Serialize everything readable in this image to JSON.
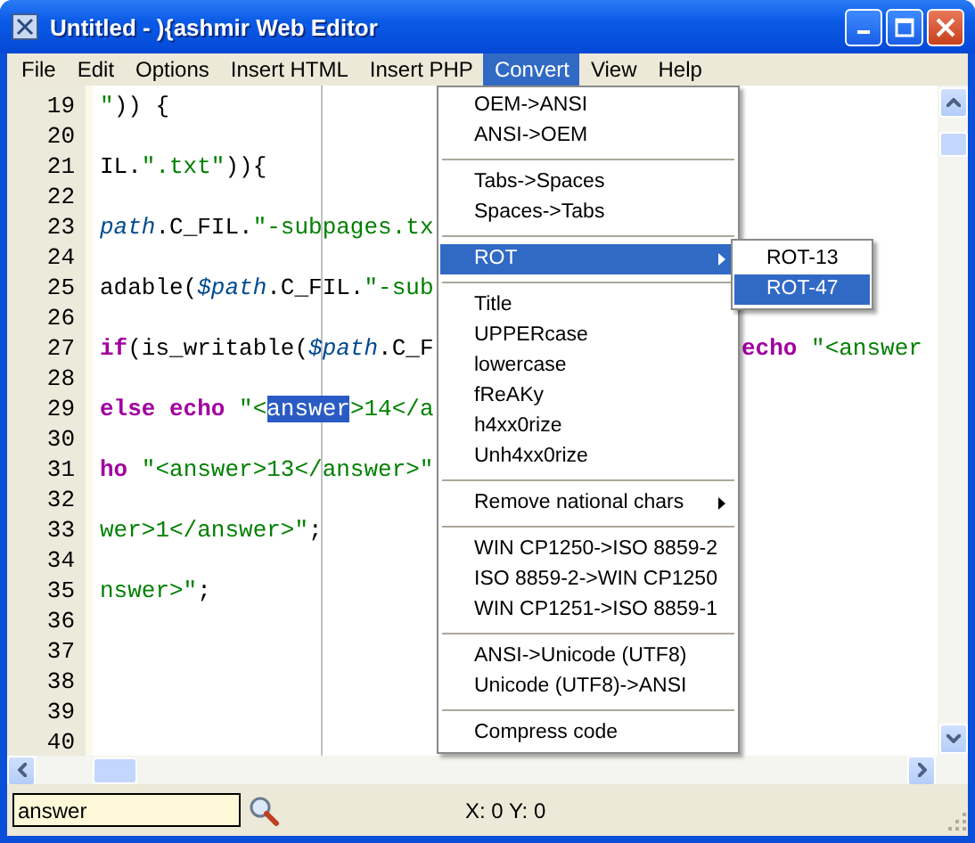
{
  "window": {
    "title": "Untitled - ){ashmir Web Editor"
  },
  "menu_bar": [
    {
      "label": "File",
      "selected": false
    },
    {
      "label": "Edit",
      "selected": false
    },
    {
      "label": "Options",
      "selected": false
    },
    {
      "label": "Insert HTML",
      "selected": false
    },
    {
      "label": "Insert PHP",
      "selected": false
    },
    {
      "label": "Convert",
      "selected": true
    },
    {
      "label": "View",
      "selected": false
    },
    {
      "label": "Help",
      "selected": false
    }
  ],
  "editor": {
    "lines": [
      {
        "number": "19",
        "segments": [
          {
            "kind": "string",
            "text": "\""
          },
          {
            "kind": "plain",
            "text": ")) {"
          }
        ]
      },
      {
        "number": "20"
      },
      {
        "number": "21",
        "segments": [
          {
            "kind": "plain",
            "text": "IL."
          },
          {
            "kind": "string",
            "text": "\".txt\""
          },
          {
            "kind": "plain",
            "text": ")){"
          }
        ]
      },
      {
        "number": "22"
      },
      {
        "number": "23",
        "segments": [
          {
            "kind": "variable",
            "text": "path"
          },
          {
            "kind": "plain",
            "text": ".C_FIL."
          },
          {
            "kind": "string",
            "text": "\"-subpages.tx"
          }
        ]
      },
      {
        "number": "24"
      },
      {
        "number": "25",
        "segments": [
          {
            "kind": "plain",
            "text": "adable("
          },
          {
            "kind": "variable",
            "text": "$path"
          },
          {
            "kind": "plain",
            "text": ".C_FIL."
          },
          {
            "kind": "string",
            "text": "\"-sub"
          }
        ]
      },
      {
        "number": "26"
      },
      {
        "number": "27",
        "segments": [
          {
            "kind": "keyword",
            "text": "if"
          },
          {
            "kind": "plain",
            "text": "(is_writable("
          },
          {
            "kind": "variable",
            "text": "$path"
          },
          {
            "kind": "plain",
            "text": ".C_F"
          }
        ],
        "right_segments": [
          {
            "kind": "keyword",
            "text": "echo"
          },
          {
            "kind": "string",
            "text": " \"<answer"
          }
        ]
      },
      {
        "number": "28"
      },
      {
        "number": "29",
        "segments": [
          {
            "kind": "keyword",
            "text": "else echo"
          },
          {
            "kind": "string",
            "text": " \"<"
          },
          {
            "kind": "selection",
            "text": "answer"
          },
          {
            "kind": "string",
            "text": ">14</a"
          }
        ]
      },
      {
        "number": "30"
      },
      {
        "number": "31",
        "segments": [
          {
            "kind": "keyword",
            "text": "ho"
          },
          {
            "kind": "string",
            "text": " \"<answer>13</answer>\""
          }
        ]
      },
      {
        "number": "32"
      },
      {
        "number": "33",
        "segments": [
          {
            "kind": "string",
            "text": "wer>1</answer>\""
          },
          {
            "kind": "plain",
            "text": ";"
          }
        ]
      },
      {
        "number": "34"
      },
      {
        "number": "35",
        "segments": [
          {
            "kind": "string",
            "text": "nswer>\""
          },
          {
            "kind": "plain",
            "text": ";"
          }
        ]
      },
      {
        "number": "36"
      },
      {
        "number": "37"
      },
      {
        "number": "38"
      },
      {
        "number": "39"
      },
      {
        "number": "40"
      }
    ]
  },
  "convert_menu": {
    "items": [
      {
        "kind": "item",
        "label": "OEM->ANSI",
        "selected": false
      },
      {
        "kind": "item",
        "label": "ANSI->OEM",
        "selected": false
      },
      {
        "kind": "separator"
      },
      {
        "kind": "item",
        "label": "Tabs->Spaces",
        "selected": false
      },
      {
        "kind": "item",
        "label": "Spaces->Tabs",
        "selected": false
      },
      {
        "kind": "separator"
      },
      {
        "kind": "submenu",
        "label": "ROT",
        "selected": true
      },
      {
        "kind": "separator"
      },
      {
        "kind": "item",
        "label": "Title",
        "selected": false
      },
      {
        "kind": "item",
        "label": "UPPERcase",
        "selected": false
      },
      {
        "kind": "item",
        "label": "lowercase",
        "selected": false
      },
      {
        "kind": "item",
        "label": "fReAKy",
        "selected": false
      },
      {
        "kind": "item",
        "label": "h4xx0rize",
        "selected": false
      },
      {
        "kind": "item",
        "label": "Unh4xx0rize",
        "selected": false
      },
      {
        "kind": "separator"
      },
      {
        "kind": "submenu",
        "label": "Remove national chars",
        "selected": false
      },
      {
        "kind": "separator"
      },
      {
        "kind": "item",
        "label": "WIN CP1250->ISO 8859-2",
        "selected": false
      },
      {
        "kind": "item",
        "label": "ISO 8859-2->WIN CP1250",
        "selected": false
      },
      {
        "kind": "item",
        "label": "WIN CP1251->ISO 8859-1",
        "selected": false
      },
      {
        "kind": "separator"
      },
      {
        "kind": "item",
        "label": "ANSI->Unicode (UTF8)",
        "selected": false
      },
      {
        "kind": "item",
        "label": "Unicode (UTF8)->ANSI",
        "selected": false
      },
      {
        "kind": "separator"
      },
      {
        "kind": "item",
        "label": "Compress code",
        "selected": false
      }
    ]
  },
  "rot_submenu": {
    "items": [
      {
        "kind": "item",
        "label": "ROT-13",
        "selected": false
      },
      {
        "kind": "item",
        "label": "ROT-47",
        "selected": true
      }
    ]
  },
  "search": {
    "value": "answer"
  },
  "status_bar": {
    "position": "X: 0 Y: 0"
  }
}
